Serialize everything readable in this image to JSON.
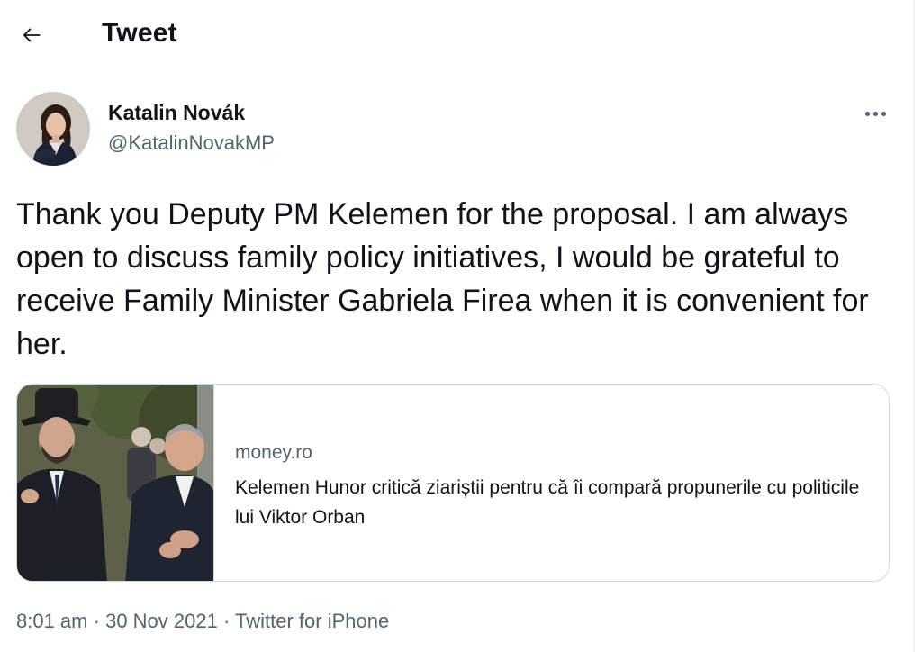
{
  "header": {
    "title": "Tweet",
    "back_icon": "arrow-left-icon"
  },
  "author": {
    "name": "Katalin Novák",
    "handle": "@KatalinNovakMP"
  },
  "tweet": {
    "text": "Thank you Deputy PM Kelemen for the proposal. I am always open to discuss family policy initiatives, I would be grateful to receive Family Minister Gabriela Firea when it is convenient for her."
  },
  "card": {
    "domain": "money.ro",
    "title": "Kelemen Hunor critică ziariștii pentru că îi compară propunerile cu politicile lui Viktor Orban"
  },
  "meta": {
    "time": "8:01 am",
    "separator": "·",
    "date": "30 Nov 2021",
    "source": "Twitter for iPhone"
  },
  "colors": {
    "text_primary": "#0f1419",
    "text_secondary": "#536471",
    "border": "#cfd9de"
  }
}
